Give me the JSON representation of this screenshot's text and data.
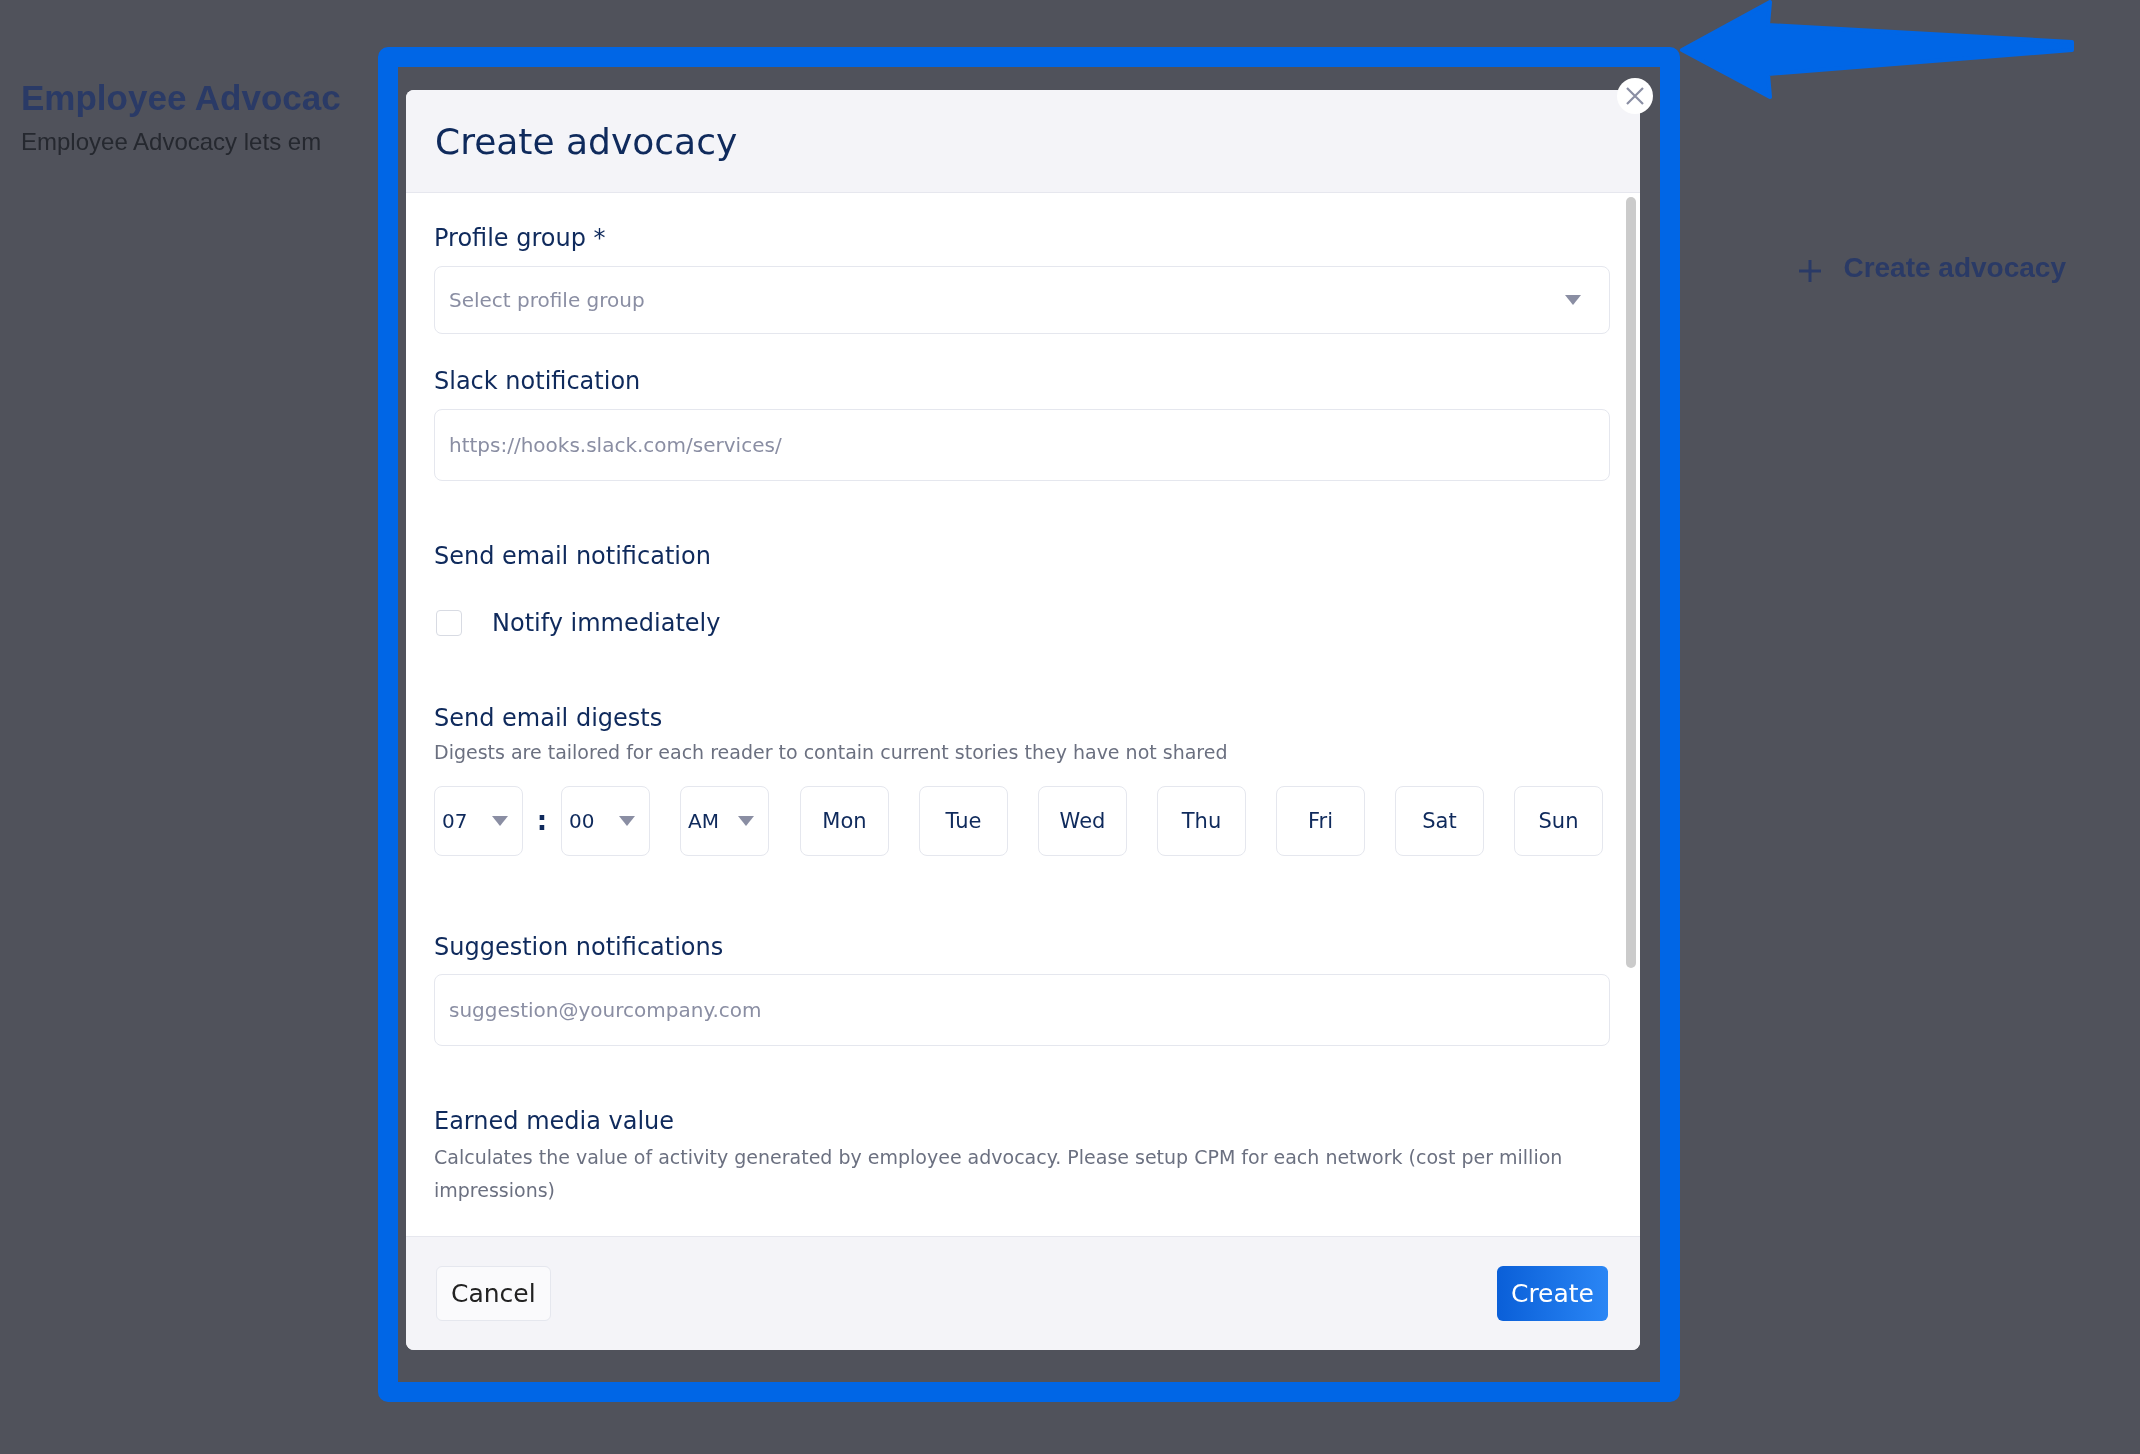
{
  "page": {
    "title": "Employee Advocac",
    "subtitle": "Employee Advocacy lets em",
    "create_button": "Create advocacy"
  },
  "dialog": {
    "title": "Create advocacy",
    "profile_group": {
      "label": "Profile group *",
      "placeholder": "Select profile group"
    },
    "slack": {
      "label": "Slack notification",
      "placeholder": "https://hooks.slack.com/services/"
    },
    "email": {
      "label": "Send email notification",
      "checkbox": {
        "label": "Notify immediately",
        "checked": false
      }
    },
    "digests": {
      "label": "Send email digests",
      "description": "Digests are tailored for each reader to contain current stories they have not shared",
      "hour": "07",
      "separator": ":",
      "minute": "00",
      "period": "AM",
      "days": [
        {
          "label": "Mon",
          "selected": false
        },
        {
          "label": "Tue",
          "selected": false
        },
        {
          "label": "Wed",
          "selected": false
        },
        {
          "label": "Thu",
          "selected": false
        },
        {
          "label": "Fri",
          "selected": false
        },
        {
          "label": "Sat",
          "selected": false
        },
        {
          "label": "Sun",
          "selected": false
        }
      ]
    },
    "suggestion": {
      "label": "Suggestion notifications",
      "placeholder": "suggestion@yourcompany.com"
    },
    "earned_media": {
      "label": "Earned media value",
      "description": "Calculates the value of activity generated by employee advocacy. Please setup CPM for each network (cost per million impressions)"
    },
    "buttons": {
      "cancel": "Cancel",
      "create": "Create"
    }
  }
}
